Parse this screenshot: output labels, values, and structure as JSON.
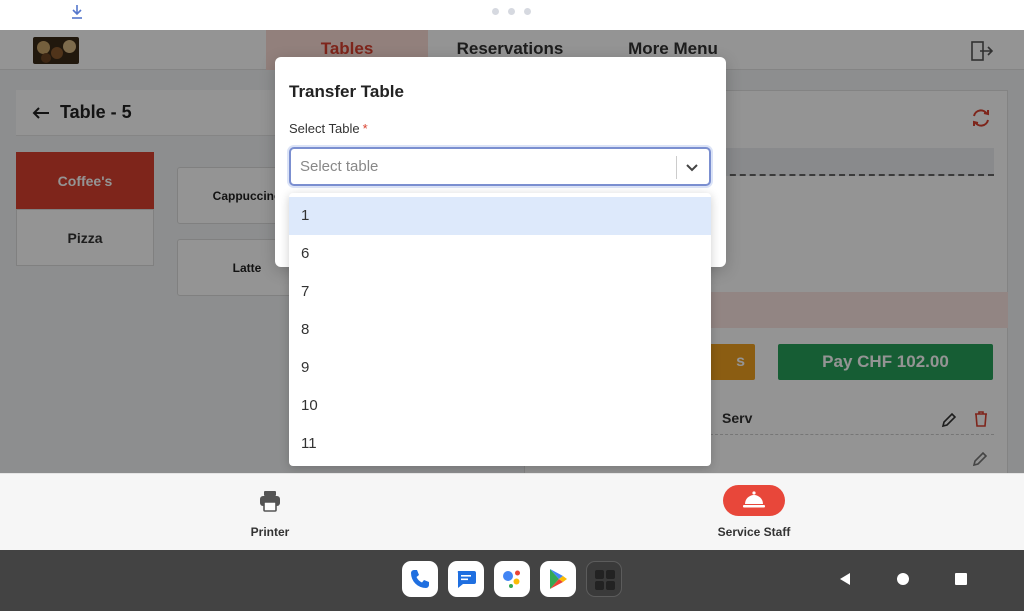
{
  "status": {
    "download_icon": "download-icon"
  },
  "topnav": {
    "tabs": [
      {
        "label": "Tables",
        "active": true
      },
      {
        "label": "Reservations",
        "active": false
      },
      {
        "label": "More Menu",
        "active": false
      }
    ],
    "logout_icon": "logout-icon"
  },
  "order": {
    "table_title": "Table - 5",
    "categories": [
      {
        "label": "Coffee's",
        "active": true
      },
      {
        "label": "Pizza",
        "active": false
      }
    ],
    "products": [
      "Cappuccino",
      "Latte"
    ],
    "pay_button": "Pay CHF 102.00",
    "orange_button_tail": "s",
    "serv_label": "Serv"
  },
  "modal": {
    "title": "Transfer Table",
    "field_label": "Select Table",
    "required_mark": "*",
    "placeholder": "Select table",
    "options": [
      "1",
      "6",
      "7",
      "8",
      "9",
      "10",
      "11"
    ],
    "highlighted_index": 0
  },
  "bottombar": {
    "printer_label": "Printer",
    "service_staff_label": "Service Staff"
  },
  "colors": {
    "accent": "#d9412f",
    "pay": "#27a05a",
    "orange": "#f0a020",
    "select_border": "#7b8fd0",
    "highlight": "#dde9fb"
  }
}
